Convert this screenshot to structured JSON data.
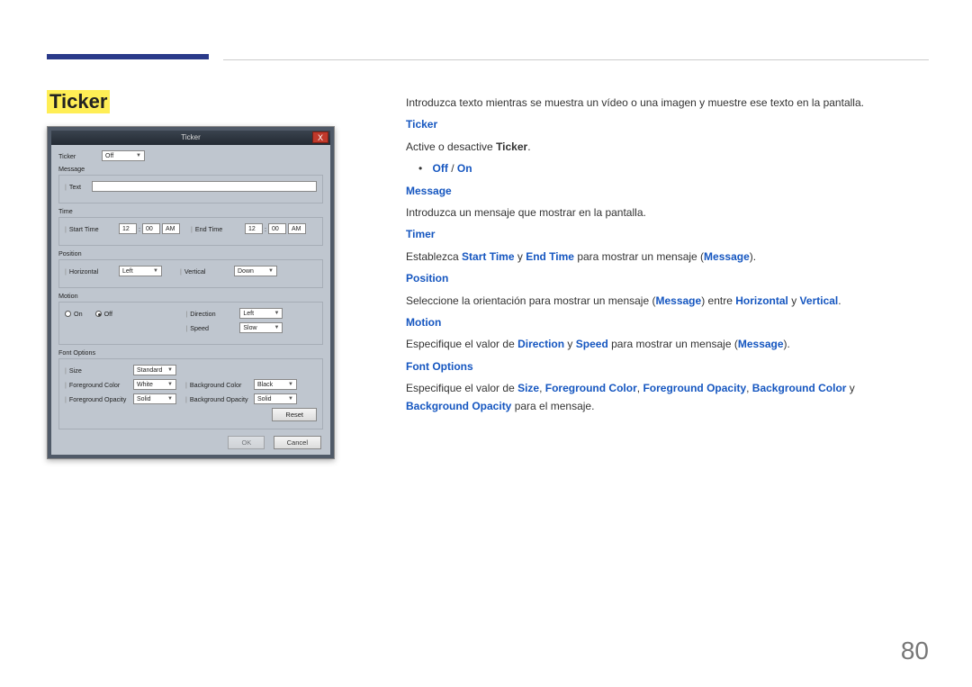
{
  "page_number": "80",
  "page_title": "Ticker",
  "intro": "Introduzca texto mientras se muestra un vídeo o una imagen y muestre ese texto en la pantalla.",
  "s1_head": "Ticker",
  "s1_text_a": "Active o desactive ",
  "s1_text_b": "Ticker",
  "s1_text_c": ".",
  "s1_opt_off": "Off",
  "s1_opt_on": "On",
  "s2_head": "Message",
  "s2_text": "Introduzca un mensaje que mostrar en la pantalla.",
  "s3_head": "Timer",
  "s3_text_a": "Establezca ",
  "s3_kw1": "Start Time",
  "s3_text_b": " y ",
  "s3_kw2": "End Time",
  "s3_text_c": " para mostrar un mensaje (",
  "s3_kw3": "Message",
  "s3_text_d": ").",
  "s4_head": "Position",
  "s4_text_a": "Seleccione la orientación para mostrar un mensaje (",
  "s4_kw1": "Message",
  "s4_text_b": ") entre ",
  "s4_kw2": "Horizontal",
  "s4_text_c": " y ",
  "s4_kw3": "Vertical",
  "s4_text_d": ".",
  "s5_head": "Motion",
  "s5_text_a": "Especifique el valor de ",
  "s5_kw1": "Direction",
  "s5_text_b": " y ",
  "s5_kw2": "Speed",
  "s5_text_c": " para mostrar un mensaje (",
  "s5_kw3": "Message",
  "s5_text_d": ").",
  "s6_head": "Font Options",
  "s6_text_a": "Especifique el valor de ",
  "s6_kw1": "Size",
  "s6_text_b": ", ",
  "s6_kw2": "Foreground Color",
  "s6_text_c": ", ",
  "s6_kw3": "Foreground Opacity",
  "s6_text_d": ", ",
  "s6_kw4": "Background Color",
  "s6_text_e": " y ",
  "s6_kw5": "Background Opacity",
  "s6_text_f": " para el mensaje.",
  "dlg": {
    "title": "Ticker",
    "close": "X",
    "ticker_lbl": "Ticker",
    "ticker_val": "Off",
    "message_lbl": "Message",
    "text_lbl": "Text",
    "time_lbl": "Time",
    "start_time_lbl": "Start Time",
    "start_h": "12",
    "start_m": "00",
    "start_ampm": "AM",
    "end_time_lbl": "End Time",
    "end_h": "12",
    "end_m": "00",
    "end_ampm": "AM",
    "position_lbl": "Position",
    "horiz_lbl": "Horizontal",
    "horiz_val": "Left",
    "vert_lbl": "Vertical",
    "vert_val": "Down",
    "motion_lbl": "Motion",
    "on_lbl": "On",
    "off_lbl": "Off",
    "dir_lbl": "Direction",
    "dir_val": "Left",
    "speed_lbl": "Speed",
    "speed_val": "Slow",
    "font_lbl": "Font Options",
    "size_lbl": "Size",
    "size_val": "Standard",
    "fg_lbl": "Foreground Color",
    "fg_val": "White",
    "bg_lbl": "Background Color",
    "bg_val": "Black",
    "fo_lbl": "Foreground Opacity",
    "fo_val": "Solid",
    "bo_lbl": "Background Opacity",
    "bo_val": "Solid",
    "reset": "Reset",
    "ok": "OK",
    "cancel": "Cancel"
  }
}
